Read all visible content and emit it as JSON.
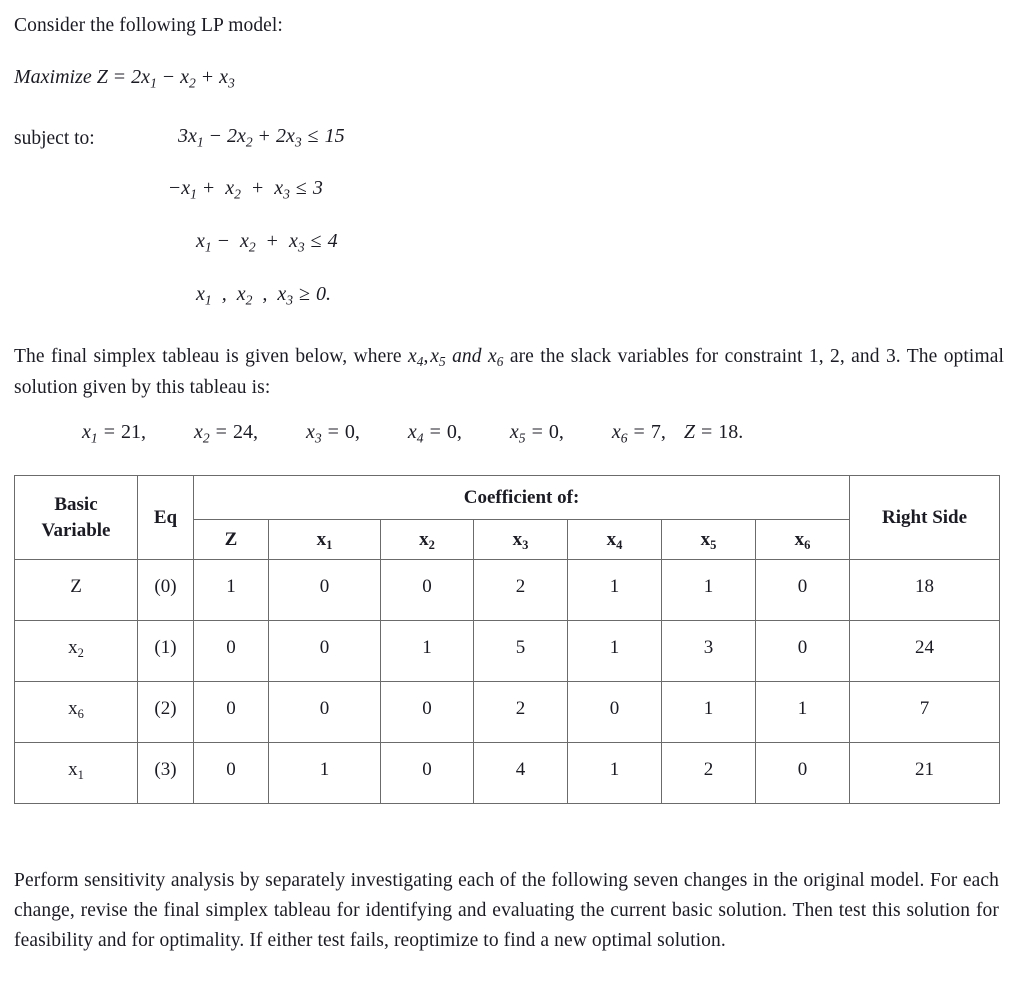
{
  "document": {
    "intro": "Consider the following LP model:",
    "objective": {
      "label": "Maximize Z",
      "equals": "=",
      "terms": "2x₁ − x₂ + x₃"
    },
    "subject_to_label": "subject to:",
    "constraints": [
      "3x₁ − 2x₂ + 2x₃ ≤ 15",
      "−x₁ + x₂ + x₃ ≤ 3",
      "x₁ − x₂ + x₃ ≤ 4",
      "x₁ , x₂ , x₃ ≥ 0."
    ],
    "tableau_intro": "The final simplex tableau is given below, where x₄, x₅ and x₆ are the slack variables for constraint 1, 2, and 3. The optimal solution given by this tableau is:",
    "solution": [
      {
        "var": "x",
        "idx": "1",
        "eq": "=",
        "val": "21,"
      },
      {
        "var": "x",
        "idx": "2",
        "eq": "=",
        "val": "24,"
      },
      {
        "var": "x",
        "idx": "3",
        "eq": "=",
        "val": "0,"
      },
      {
        "var": "x",
        "idx": "4",
        "eq": "=",
        "val": "0,"
      },
      {
        "var": "x",
        "idx": "5",
        "eq": "=",
        "val": "0,"
      },
      {
        "var": "x",
        "idx": "6",
        "eq": "=",
        "val": "7,"
      },
      {
        "var": "Z",
        "idx": "",
        "eq": "=",
        "val": "18."
      }
    ],
    "closing": "Perform sensitivity analysis by separately investigating each of the following seven changes in the original model. For each change, revise the final simplex tableau for identifying and evaluating the current basic solution. Then test this solution for feasibility and for optimality. If either test fails, reoptimize to find a new optimal solution."
  },
  "table": {
    "header": {
      "basic_variable_line1": "Basic",
      "basic_variable_line2": "Variable",
      "eq": "Eq",
      "coefficient_of": "Coefficient of:",
      "right_side": "Right Side",
      "columns": [
        {
          "base": "Z",
          "sub": ""
        },
        {
          "base": "x",
          "sub": "1"
        },
        {
          "base": "x",
          "sub": "2"
        },
        {
          "base": "x",
          "sub": "3"
        },
        {
          "base": "x",
          "sub": "4"
        },
        {
          "base": "x",
          "sub": "5"
        },
        {
          "base": "x",
          "sub": "6"
        }
      ]
    },
    "rows": [
      {
        "basic_base": "Z",
        "basic_sub": "",
        "eq": "(0)",
        "values": [
          "1",
          "0",
          "0",
          "2",
          "1",
          "1",
          "0"
        ],
        "right_side": "18"
      },
      {
        "basic_base": "x",
        "basic_sub": "2",
        "eq": "(1)",
        "values": [
          "0",
          "0",
          "1",
          "5",
          "1",
          "3",
          "0"
        ],
        "right_side": "24"
      },
      {
        "basic_base": "x",
        "basic_sub": "6",
        "eq": "(2)",
        "values": [
          "0",
          "0",
          "0",
          "2",
          "0",
          "1",
          "1"
        ],
        "right_side": "7"
      },
      {
        "basic_base": "x",
        "basic_sub": "1",
        "eq": "(3)",
        "values": [
          "0",
          "1",
          "0",
          "4",
          "1",
          "2",
          "0"
        ],
        "right_side": "21"
      }
    ]
  },
  "colors": {
    "text": "#1b1b24",
    "border": "#6b6b6b",
    "background": "#ffffff"
  }
}
